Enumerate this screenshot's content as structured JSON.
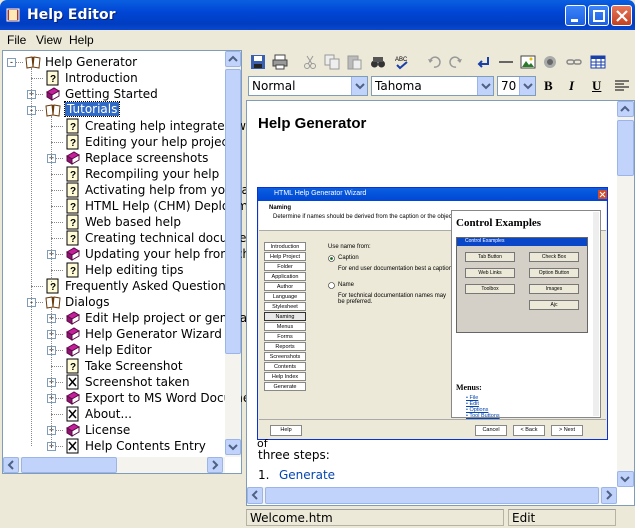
{
  "window": {
    "title": "Help Editor",
    "buttons": [
      "minimize",
      "maximize",
      "close"
    ]
  },
  "menu": [
    "File",
    "View",
    "Help"
  ],
  "tree": {
    "items": [
      {
        "label": "Help Generator",
        "level": 0,
        "icon": "book-open-icon",
        "expander": "-"
      },
      {
        "label": "Introduction",
        "level": 1,
        "icon": "help-page-icon",
        "expander": ""
      },
      {
        "label": "Getting Started",
        "level": 1,
        "icon": "book-closed-icon",
        "expander": "+"
      },
      {
        "label": "Tutorials",
        "level": 1,
        "icon": "book-open-icon",
        "expander": "-",
        "selected": true
      },
      {
        "label": "Creating help integrated with",
        "level": 2,
        "icon": "help-page-icon",
        "expander": ""
      },
      {
        "label": "Editing your help project",
        "level": 2,
        "icon": "help-page-icon",
        "expander": ""
      },
      {
        "label": "Replace screenshots",
        "level": 2,
        "icon": "book-closed-icon",
        "expander": "+"
      },
      {
        "label": "Recompiling your help",
        "level": 2,
        "icon": "help-page-icon",
        "expander": ""
      },
      {
        "label": "Activating help from your app",
        "level": 2,
        "icon": "help-page-icon",
        "expander": ""
      },
      {
        "label": "HTML Help (CHM) Deployme",
        "level": 2,
        "icon": "help-page-icon",
        "expander": ""
      },
      {
        "label": "Web based help",
        "level": 2,
        "icon": "help-page-icon",
        "expander": ""
      },
      {
        "label": "Creating technical documenta",
        "level": 2,
        "icon": "help-page-icon",
        "expander": ""
      },
      {
        "label": "Updating your help from char",
        "level": 2,
        "icon": "book-closed-icon",
        "expander": "+"
      },
      {
        "label": "Help editing tips",
        "level": 2,
        "icon": "help-page-icon",
        "expander": ""
      },
      {
        "label": "Frequently Asked Questions",
        "level": 1,
        "icon": "help-page-icon",
        "expander": ""
      },
      {
        "label": "Dialogs",
        "level": 1,
        "icon": "book-open-icon",
        "expander": "-"
      },
      {
        "label": "Edit Help project or generate",
        "level": 2,
        "icon": "book-closed-icon",
        "expander": "+"
      },
      {
        "label": "Help Generator Wizard",
        "level": 2,
        "icon": "book-closed-icon",
        "expander": "+"
      },
      {
        "label": "Help Editor",
        "level": 2,
        "icon": "book-closed-icon",
        "expander": "+"
      },
      {
        "label": "Take Screenshot",
        "level": 2,
        "icon": "help-page-icon",
        "expander": ""
      },
      {
        "label": "Screenshot taken",
        "level": 2,
        "icon": "missing-page-icon",
        "expander": "+"
      },
      {
        "label": "Export to MS Word Documer",
        "level": 2,
        "icon": "book-closed-icon",
        "expander": "+"
      },
      {
        "label": "About...",
        "level": 2,
        "icon": "missing-page-icon",
        "expander": ""
      },
      {
        "label": "License",
        "level": 2,
        "icon": "book-closed-icon",
        "expander": "+"
      },
      {
        "label": "Help Contents Entry",
        "level": 2,
        "icon": "missing-page-icon",
        "expander": "+"
      }
    ]
  },
  "toolbar": {
    "icons": [
      "save-icon",
      "print-icon",
      "cut-icon",
      "copy-icon",
      "paste-icon",
      "find-icon",
      "spellcheck-icon",
      "undo-icon",
      "redo-icon",
      "insert-link-icon",
      "horizontal-rule-icon",
      "insert-image-icon",
      "screenshot-icon",
      "link-chain-icon",
      "table-icon"
    ]
  },
  "format": {
    "style": "Normal",
    "font": "Tahoma",
    "size": "70",
    "bold": "B",
    "italic": "I",
    "underline": "U"
  },
  "document": {
    "title": "Help Generator",
    "screenshot": {
      "title": "HTML Help Generator Wizard",
      "heading": "Naming",
      "subheading": "Determine if names should be derived from the caption or the objectname",
      "nav": [
        "Introduction",
        "Help Project",
        "Folder",
        "Application",
        "Author",
        "Language",
        "Stylesheet",
        "Naming",
        "Menus",
        "Forms",
        "Reports",
        "Screenshots",
        "Contents",
        "Help Index",
        "Generate"
      ],
      "use_name_from": "Use name from:",
      "option_caption": "Caption",
      "option_caption_desc": "For end user documentation best a caption.",
      "option_name": "Name",
      "option_name_desc": "For technical documentation names may be preferred.",
      "panel_title": "Control Examples",
      "panel_window": "Control Examples",
      "panel_menus": "Menus:",
      "panel_links": [
        "File",
        "Edit",
        "Options",
        "Tool Buttons"
      ],
      "panel_buttons": [
        "Tab Button",
        "Check Box",
        "Web Links",
        "Option Button",
        "Toolbox",
        "Images",
        "Ajc"
      ],
      "footer_help": "Help",
      "footer_cancel": "Cancel",
      "footer_back": "< Back",
      "footer_next": "> Next"
    },
    "fragment": "of",
    "para": "three steps:",
    "list_number": "1.",
    "list_link": "Generate"
  },
  "status": {
    "file": "Welcome.htm",
    "mode": "Edit"
  },
  "colors": {
    "titlebar": "#0046d5",
    "selection": "#316ac5",
    "link": "#0645ad"
  }
}
